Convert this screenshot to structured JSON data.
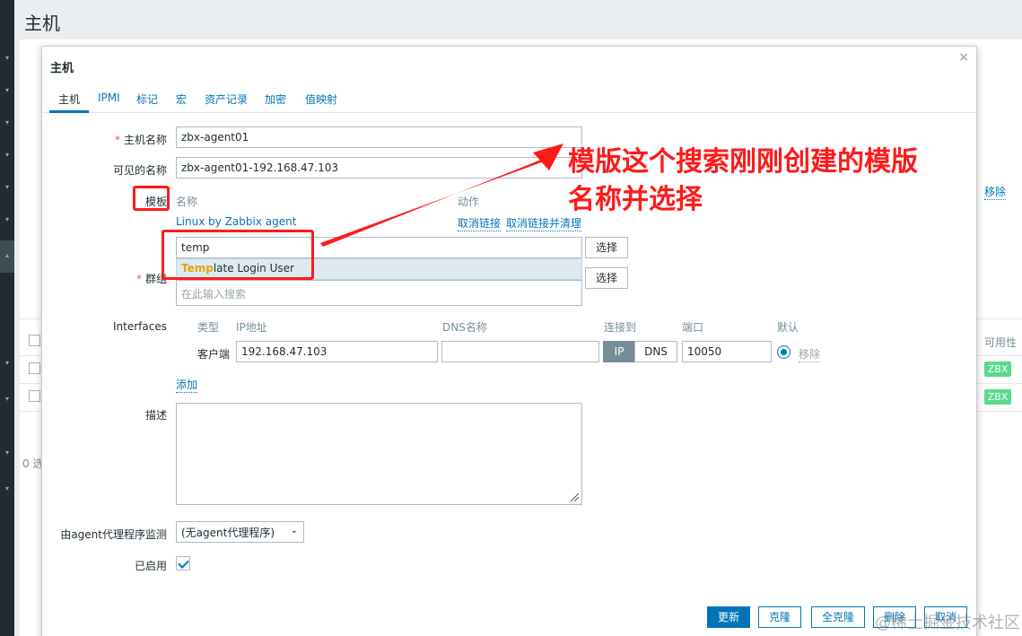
{
  "background": {
    "page_title": "主机",
    "right_remove": "移除",
    "availability_header": "可用性",
    "zbx_badges": [
      "ZBX",
      "ZBX"
    ],
    "count_text": "0 选"
  },
  "dialog": {
    "title": "主机",
    "close_symbol": "×",
    "tabs": [
      {
        "label": "主机",
        "active": true
      },
      {
        "label": "IPMI"
      },
      {
        "label": "标记"
      },
      {
        "label": "宏"
      },
      {
        "label": "资产记录"
      },
      {
        "label": "加密"
      },
      {
        "label": "值映射"
      }
    ],
    "host_name": {
      "label": "主机名称",
      "required_mark": "*",
      "value": "zbx-agent01"
    },
    "visible_name": {
      "label": "可见的名称",
      "value": "zbx-agent01-192.168.47.103"
    },
    "templates": {
      "label": "模板",
      "col_name": "名称",
      "col_action": "动作",
      "linked": "Linux by Zabbix agent",
      "unlink": "取消链接",
      "unlink_clear": "取消链接并清理",
      "search_value": "temp",
      "select_button": "选择",
      "suggestion_match": "Temp",
      "suggestion_rest": "late Login User"
    },
    "groups": {
      "label": "群组",
      "required_mark": "*",
      "placeholder": "在此输入搜索",
      "select_button": "选择"
    },
    "interfaces": {
      "label": "Interfaces",
      "col_type": "类型",
      "col_ip": "IP地址",
      "col_dns": "DNS名称",
      "col_connect": "连接到",
      "col_port": "端口",
      "col_default": "默认",
      "row_type": "客户端",
      "ip_value": "192.168.47.103",
      "dns_value": "",
      "connect_ip": "IP",
      "connect_dns": "DNS",
      "port_value": "10050",
      "remove": "移除",
      "add": "添加"
    },
    "description": {
      "label": "描述",
      "value": ""
    },
    "proxy": {
      "label": "由agent代理程序监测",
      "value": "(无agent代理程序)"
    },
    "enabled": {
      "label": "已启用",
      "checked": true
    },
    "buttons": {
      "update": "更新",
      "clone": "克隆",
      "full_clone": "全克隆",
      "delete": "删除",
      "cancel": "取消"
    }
  },
  "annotation": {
    "text_line1": "模版这个搜索刚刚创建的模版",
    "text_line2": "名称并选择",
    "color": "#ff1a1a"
  },
  "watermark": "@稀土掘金技术社区"
}
